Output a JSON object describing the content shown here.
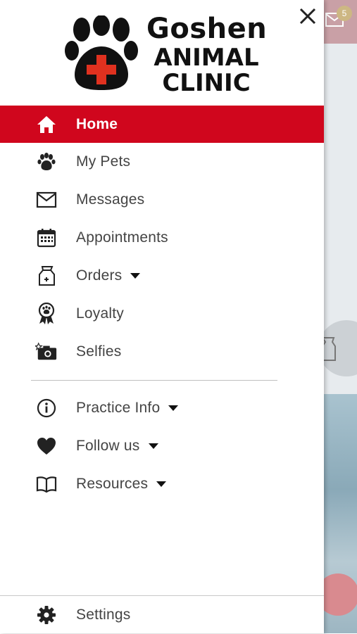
{
  "colors": {
    "accent": "#d0061d",
    "text": "#444444",
    "icon": "#222222"
  },
  "background_app": {
    "badge_count": "5"
  },
  "logo": {
    "line1": "Goshen",
    "line2": "ANIMAL",
    "line3": "CLINIC"
  },
  "menu": {
    "home": {
      "label": "Home",
      "icon": "home-icon"
    },
    "my_pets": {
      "label": "My Pets",
      "icon": "paw-icon"
    },
    "messages": {
      "label": "Messages",
      "icon": "envelope-icon"
    },
    "appointments": {
      "label": "Appointments",
      "icon": "calendar-icon"
    },
    "orders": {
      "label": "Orders",
      "icon": "food-bag-icon"
    },
    "loyalty": {
      "label": "Loyalty",
      "icon": "award-ribbon-icon"
    },
    "selfies": {
      "label": "Selfies",
      "icon": "camera-icon"
    }
  },
  "secondary_menu": {
    "practice_info": {
      "label": "Practice Info",
      "icon": "info-icon"
    },
    "follow_us": {
      "label": "Follow us",
      "icon": "heart-icon"
    },
    "resources": {
      "label": "Resources",
      "icon": "book-icon"
    }
  },
  "footer": {
    "settings": {
      "label": "Settings",
      "icon": "gear-icon"
    }
  }
}
